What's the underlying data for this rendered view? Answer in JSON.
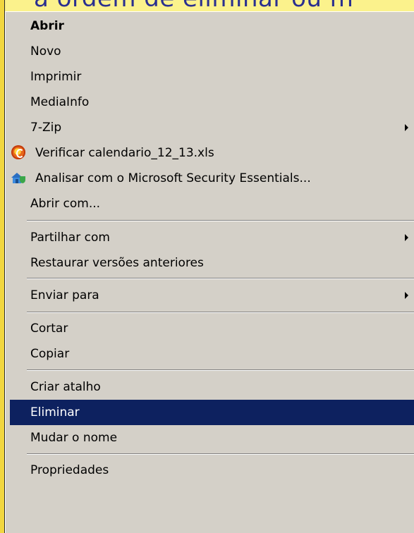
{
  "background": {
    "partial_text": "a ordem de eliminar ou m"
  },
  "menu": {
    "items": [
      {
        "label": "Abrir",
        "bold": true
      },
      {
        "label": "Novo"
      },
      {
        "label": "Imprimir"
      },
      {
        "label": "MediaInfo"
      },
      {
        "label": "7-Zip",
        "submenu": true
      },
      {
        "label": "Verificar calendario_12_13.xls",
        "icon": "verify-icon"
      },
      {
        "label": "Analisar com o Microsoft Security Essentials...",
        "icon": "security-essentials-icon"
      },
      {
        "label": "Abrir com..."
      },
      {
        "label": "Partilhar com",
        "submenu": true
      },
      {
        "label": "Restaurar versões anteriores"
      },
      {
        "label": "Enviar para",
        "submenu": true
      },
      {
        "label": "Cortar"
      },
      {
        "label": "Copiar"
      },
      {
        "label": "Criar atalho"
      },
      {
        "label": "Eliminar",
        "selected": true
      },
      {
        "label": "Mudar o nome"
      },
      {
        "label": "Propriedades"
      }
    ]
  },
  "colors": {
    "menu_background": "#d4d0c8",
    "selection": "#0d215f",
    "background_strip": "#fbf28c",
    "background_text": "#2a2f8f"
  }
}
